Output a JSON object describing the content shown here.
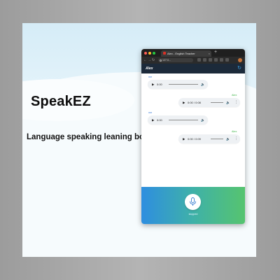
{
  "brand": {
    "name": "SpeakEZ",
    "tagline": "Language speaking leaning bot"
  },
  "browser": {
    "tab_title": "Alex - English Teacher",
    "tab_close": "×",
    "new_tab": "+",
    "address": "127.0..."
  },
  "app": {
    "title": "Alex",
    "refresh_icon": "refresh-icon"
  },
  "messages": [
    {
      "speaker": "me",
      "side": "left",
      "time": "0:00",
      "player_type": "compact"
    },
    {
      "speaker": "Alex",
      "side": "right",
      "time": "0:00 / 0:08",
      "player_type": "full"
    },
    {
      "speaker": "me",
      "side": "left",
      "time": "0:00",
      "player_type": "compact"
    },
    {
      "speaker": "Alex",
      "side": "right",
      "time": "0:00 / 0:09",
      "player_type": "full"
    }
  ],
  "footer": {
    "mic_status": "stopped",
    "gradient": [
      "#2e8ee0",
      "#3fb1a8",
      "#56c46f"
    ]
  },
  "colors": {
    "user_label": "#3b7dd8",
    "bot_label": "#3fb44a",
    "app_bar": "#1c2a3a"
  }
}
